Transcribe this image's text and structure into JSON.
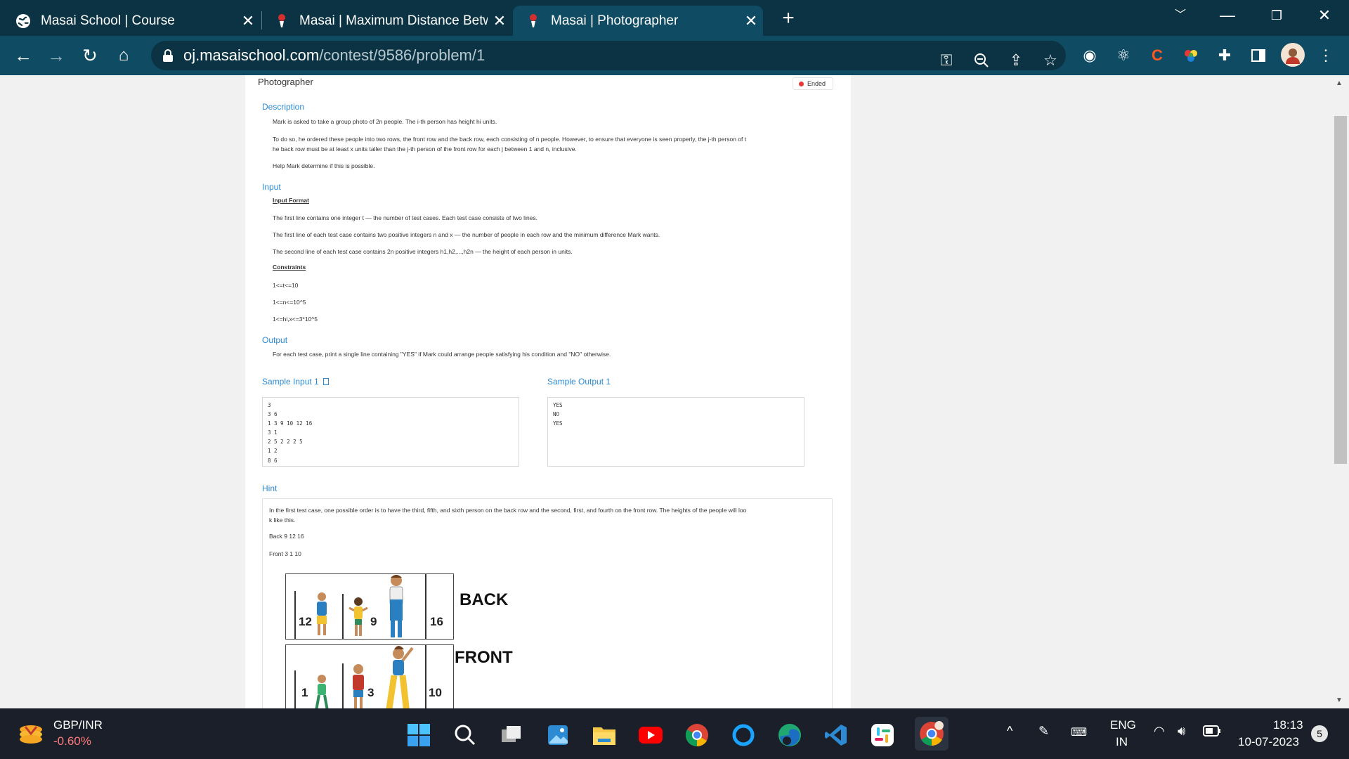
{
  "browser": {
    "tabs": [
      {
        "title": "Masai School | Course",
        "active": false
      },
      {
        "title": "Masai | Maximum Distance Betw",
        "active": false
      },
      {
        "title": "Masai | Photographer",
        "active": true
      }
    ],
    "url_host": "oj.masaischool.com",
    "url_path": "/contest/9586/problem/1"
  },
  "problem": {
    "title": "Photographer",
    "status": "Ended",
    "description_heading": "Description",
    "description": [
      "Mark is asked to take a group photo of 2n people. The i-th person has height hi units.",
      "To do so, he ordered these people into two rows, the front row and the back row, each consisting of n people. However, to ensure that everyone is seen properly, the j-th person of t",
      "he back row must be at least x units taller than the j-th person of the front row for each j between 1 and n, inclusive.",
      "Help Mark determine if this is possible."
    ],
    "input_heading": "Input",
    "input_format_label": "Input Format",
    "input_lines": [
      "The first line contains one integer t — the number of test cases. Each test case consists of two lines.",
      "The first line of each test case contains two positive integers n and x — the number of people in each row and the minimum difference Mark wants.",
      "The second line of each test case contains 2n positive integers h1,h2,...,h2n — the height of each person in units."
    ],
    "constraints_label": "Constraints",
    "constraints": [
      "1<=t<=10",
      "1<=n<=10^5",
      "1<=hi,x<=3*10^5"
    ],
    "output_heading": "Output",
    "output_text": "For each test case, print a single line containing \"YES\" if Mark could arrange people satisfying his condition and \"NO\" otherwise.",
    "sample_input_label": "Sample Input 1",
    "sample_output_label": "Sample Output 1",
    "sample_input": [
      "3",
      "3 6",
      "1 3 9 10 12 16",
      "3 1",
      "2 5 2 2 2 5",
      "1 2",
      "8 6"
    ],
    "sample_output": [
      "YES",
      "NO",
      "YES"
    ],
    "hint_heading": "Hint",
    "hint_lines": [
      "In the first test case, one possible order is to have the third, fifth, and sixth person on the back row and the second, first, and fourth on the front row. The heights of the people will loo",
      "k like this."
    ],
    "hint_back": "Back 9 12 16",
    "hint_front": "Front 3 1 10",
    "figure": {
      "back_label": "BACK",
      "front_label": "FRONT",
      "back_numbers": [
        "12",
        "9",
        "16"
      ],
      "front_numbers": [
        "1",
        "3",
        "10"
      ]
    }
  },
  "taskbar": {
    "widget_name": "GBP/INR",
    "widget_value": "-0.60%",
    "language_top": "ENG",
    "language_bottom": "IN",
    "time": "18:13",
    "date": "10-07-2023",
    "notification_count": "5"
  }
}
